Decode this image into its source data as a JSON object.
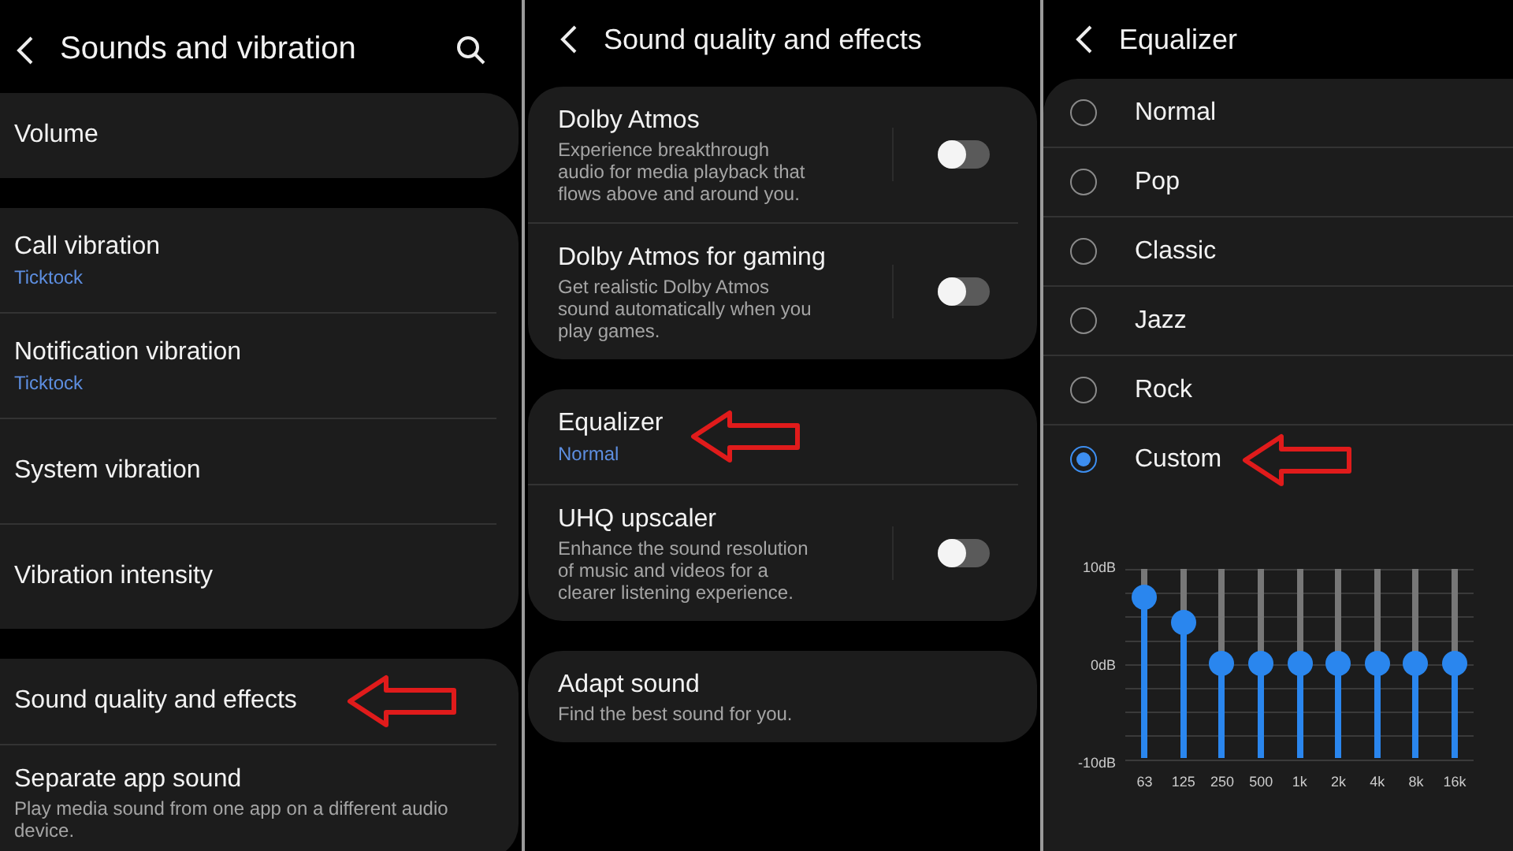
{
  "sounds_and_vibration": {
    "title": "Sounds and vibration",
    "groups": [
      {
        "items": [
          {
            "kind": "nav",
            "title": "Volume",
            "arrow": false
          }
        ]
      },
      {
        "items": [
          {
            "kind": "nav",
            "title": "Call vibration",
            "value": "Ticktock",
            "arrow": false
          },
          {
            "kind": "nav",
            "title": "Notification vibration",
            "value": "Ticktock",
            "arrow": false
          },
          {
            "kind": "nav",
            "title": "System vibration",
            "arrow": false
          },
          {
            "kind": "nav",
            "title": "Vibration intensity",
            "arrow": false
          }
        ]
      },
      {
        "items": [
          {
            "kind": "nav",
            "title": "Sound quality and effects",
            "arrow": true
          },
          {
            "kind": "nav",
            "title": "Separate app sound",
            "description": "Play media sound from one app on a different audio device.",
            "arrow": false
          }
        ]
      }
    ]
  },
  "sound_quality_and_effects": {
    "title": "Sound quality and effects",
    "groups": [
      {
        "items": [
          {
            "kind": "toggle",
            "title": "Dolby Atmos",
            "description": "Experience breakthrough audio for media playback that flows above and around you.",
            "on": false,
            "arrow": false
          },
          {
            "kind": "toggle",
            "title": "Dolby Atmos for gaming",
            "description": "Get realistic Dolby Atmos sound automatically when you play games.",
            "on": false,
            "arrow": false
          }
        ]
      },
      {
        "items": [
          {
            "kind": "nav",
            "title": "Equalizer",
            "value": "Normal",
            "arrow": true
          },
          {
            "kind": "toggle",
            "title": "UHQ upscaler",
            "description": "Enhance the sound resolution of music and videos for a clearer listening experience.",
            "on": false,
            "arrow": false
          }
        ]
      },
      {
        "items": [
          {
            "kind": "nav",
            "title": "Adapt sound",
            "description": "Find the best sound for you.",
            "arrow": false
          }
        ]
      }
    ]
  },
  "equalizer": {
    "title": "Equalizer",
    "presets": [
      {
        "label": "Normal",
        "selected": false,
        "arrow": false
      },
      {
        "label": "Pop",
        "selected": false,
        "arrow": false
      },
      {
        "label": "Classic",
        "selected": false,
        "arrow": false
      },
      {
        "label": "Jazz",
        "selected": false,
        "arrow": false
      },
      {
        "label": "Rock",
        "selected": false,
        "arrow": false
      },
      {
        "label": "Custom",
        "selected": true,
        "arrow": true
      }
    ],
    "scale": [
      "10dB",
      "0dB",
      "-10dB"
    ],
    "bands": [
      {
        "label": "63",
        "level": 0.85
      },
      {
        "label": "125",
        "level": 0.72
      },
      {
        "label": "250",
        "level": 0.5
      },
      {
        "label": "500",
        "level": 0.5
      },
      {
        "label": "1k",
        "level": 0.5
      },
      {
        "label": "2k",
        "level": 0.5
      },
      {
        "label": "4k",
        "level": 0.5
      },
      {
        "label": "8k",
        "level": 0.5
      },
      {
        "label": "16k",
        "level": 0.5
      }
    ]
  }
}
